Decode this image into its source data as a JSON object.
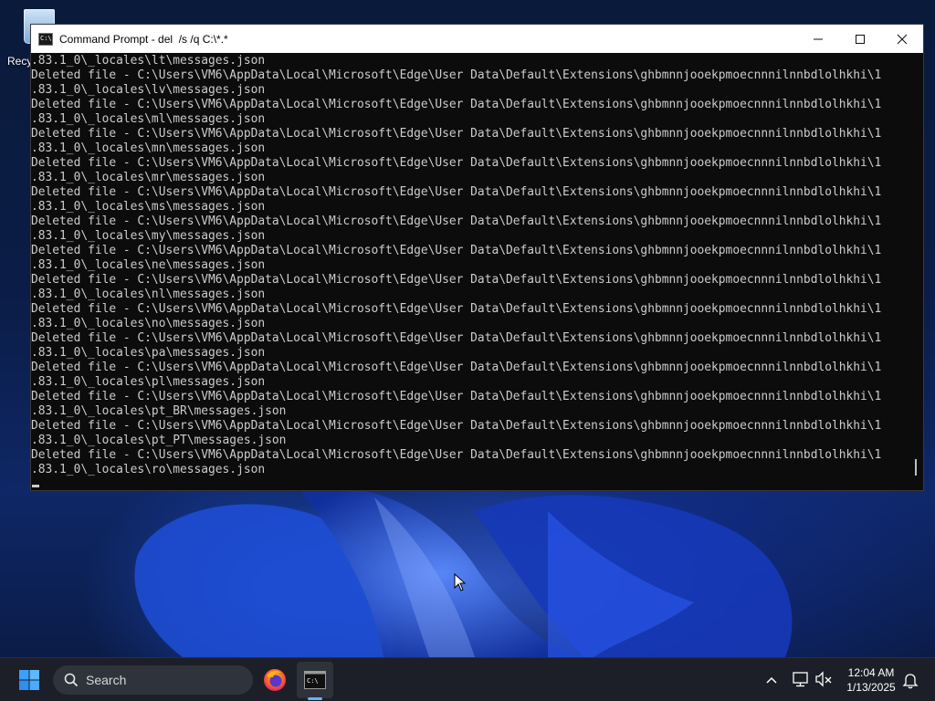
{
  "desktop": {
    "recycle_bin_label": "Recy"
  },
  "window": {
    "title": "Command Prompt - del  /s /q C:\\*.*",
    "minimize_glyph": "—",
    "maximize_glyph": "☐",
    "close_glyph": "✕"
  },
  "console": {
    "lines": [
      ".83.1_0\\_locales\\lt\\messages.json",
      "Deleted file - C:\\Users\\VM6\\AppData\\Local\\Microsoft\\Edge\\User Data\\Default\\Extensions\\ghbmnnjooekpmoecnnnilnnbdlolhkhi\\1",
      ".83.1_0\\_locales\\lv\\messages.json",
      "Deleted file - C:\\Users\\VM6\\AppData\\Local\\Microsoft\\Edge\\User Data\\Default\\Extensions\\ghbmnnjooekpmoecnnnilnnbdlolhkhi\\1",
      ".83.1_0\\_locales\\ml\\messages.json",
      "Deleted file - C:\\Users\\VM6\\AppData\\Local\\Microsoft\\Edge\\User Data\\Default\\Extensions\\ghbmnnjooekpmoecnnnilnnbdlolhkhi\\1",
      ".83.1_0\\_locales\\mn\\messages.json",
      "Deleted file - C:\\Users\\VM6\\AppData\\Local\\Microsoft\\Edge\\User Data\\Default\\Extensions\\ghbmnnjooekpmoecnnnilnnbdlolhkhi\\1",
      ".83.1_0\\_locales\\mr\\messages.json",
      "Deleted file - C:\\Users\\VM6\\AppData\\Local\\Microsoft\\Edge\\User Data\\Default\\Extensions\\ghbmnnjooekpmoecnnnilnnbdlolhkhi\\1",
      ".83.1_0\\_locales\\ms\\messages.json",
      "Deleted file - C:\\Users\\VM6\\AppData\\Local\\Microsoft\\Edge\\User Data\\Default\\Extensions\\ghbmnnjooekpmoecnnnilnnbdlolhkhi\\1",
      ".83.1_0\\_locales\\my\\messages.json",
      "Deleted file - C:\\Users\\VM6\\AppData\\Local\\Microsoft\\Edge\\User Data\\Default\\Extensions\\ghbmnnjooekpmoecnnnilnnbdlolhkhi\\1",
      ".83.1_0\\_locales\\ne\\messages.json",
      "Deleted file - C:\\Users\\VM6\\AppData\\Local\\Microsoft\\Edge\\User Data\\Default\\Extensions\\ghbmnnjooekpmoecnnnilnnbdlolhkhi\\1",
      ".83.1_0\\_locales\\nl\\messages.json",
      "Deleted file - C:\\Users\\VM6\\AppData\\Local\\Microsoft\\Edge\\User Data\\Default\\Extensions\\ghbmnnjooekpmoecnnnilnnbdlolhkhi\\1",
      ".83.1_0\\_locales\\no\\messages.json",
      "Deleted file - C:\\Users\\VM6\\AppData\\Local\\Microsoft\\Edge\\User Data\\Default\\Extensions\\ghbmnnjooekpmoecnnnilnnbdlolhkhi\\1",
      ".83.1_0\\_locales\\pa\\messages.json",
      "Deleted file - C:\\Users\\VM6\\AppData\\Local\\Microsoft\\Edge\\User Data\\Default\\Extensions\\ghbmnnjooekpmoecnnnilnnbdlolhkhi\\1",
      ".83.1_0\\_locales\\pl\\messages.json",
      "Deleted file - C:\\Users\\VM6\\AppData\\Local\\Microsoft\\Edge\\User Data\\Default\\Extensions\\ghbmnnjooekpmoecnnnilnnbdlolhkhi\\1",
      ".83.1_0\\_locales\\pt_BR\\messages.json",
      "Deleted file - C:\\Users\\VM6\\AppData\\Local\\Microsoft\\Edge\\User Data\\Default\\Extensions\\ghbmnnjooekpmoecnnnilnnbdlolhkhi\\1",
      ".83.1_0\\_locales\\pt_PT\\messages.json",
      "Deleted file - C:\\Users\\VM6\\AppData\\Local\\Microsoft\\Edge\\User Data\\Default\\Extensions\\ghbmnnjooekpmoecnnnilnnbdlolhkhi\\1",
      ".83.1_0\\_locales\\ro\\messages.json"
    ]
  },
  "taskbar": {
    "search_label": "Search",
    "pinned_apps": [
      "firefox-icon",
      "command-prompt-icon"
    ],
    "clock_time": "12:04 AM",
    "clock_date": "1/13/2025"
  },
  "colors": {
    "console_bg": "#0c0c0c",
    "console_fg": "#cccccc",
    "titlebar_bg": "#ffffff",
    "taskbar_bg": "#1c1f27",
    "accent": "#5eb7ff"
  }
}
